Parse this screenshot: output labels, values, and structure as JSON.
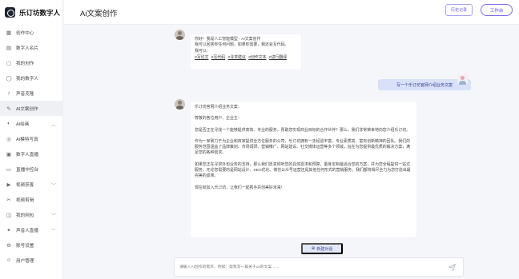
{
  "app": {
    "name": "乐订坊数字人"
  },
  "sidebar": {
    "items": [
      {
        "label": "创作中心",
        "icon": "grid-icon"
      },
      {
        "label": "数字人名片",
        "icon": "id-card-icon"
      },
      {
        "label": "我的创作",
        "icon": "document-icon"
      },
      {
        "label": "我的数字人",
        "icon": "person-icon"
      },
      {
        "label": "声音克隆",
        "icon": "sound-icon"
      },
      {
        "label": "AI文案创作",
        "icon": "edit-document-icon",
        "active": true
      },
      {
        "label": "AI绘画",
        "icon": "palette-icon",
        "expandable": true
      },
      {
        "label": "AI模特写真",
        "icon": "camera-icon"
      },
      {
        "label": "数字人直播",
        "icon": "live-icon"
      },
      {
        "label": "直播中控台",
        "icon": "monitor-icon"
      },
      {
        "label": "视频获客",
        "icon": "video-icon",
        "expandable": true
      },
      {
        "label": "视频剪辑",
        "icon": "scissors-icon"
      },
      {
        "label": "我的网包",
        "icon": "package-icon",
        "expandable": true
      },
      {
        "label": "声音人直播",
        "icon": "mic-icon",
        "expandable": true
      },
      {
        "label": "账号设置",
        "icon": "gear-icon"
      },
      {
        "label": "用户管理",
        "icon": "users-icon"
      }
    ]
  },
  "header": {
    "title": "Ai文案创作",
    "history_label": "历史记录",
    "workbench_label": "工作台"
  },
  "chat": {
    "bot_greeting": {
      "lines": [
        "你好！我是人工智能模型 - AI文案创作",
        "我可以回答你任何问题，如果你需要，我还会写代码。",
        "我可以："
      ],
      "tags": [
        "#写论文",
        "#写代码",
        "#寻求建议",
        "#创作文本",
        "#进行翻译"
      ]
    },
    "user_message": "写一个乐订坊官网介绍业务文案",
    "bot_reply": {
      "title": "乐订坊官网介绍业务文案：",
      "salutation": "尊敬的各位用户、企业主：",
      "paragraphs": [
        "您是否正在寻找一个能够提供高效、专业的服务，帮助您实现商业目标的合作伙伴？那么，我们非常荣幸地向您介绍乐订坊。",
        "作为一家致力于为企业和商家提供全方位服务的公司，乐订坊拥有一支经验丰富、专业素质高、富有创新精神的团队。我们的服务范围涵盖了品牌策划、市场调研、营销推广、网站建设、社交媒体运营等多个领域，旨在为您提供最优质的解决方案，满足您的各种需求。",
        "如果您正在寻求外包业务的支持，那么我们愿意倾听您的具体需求和预算，量身定制最适合您的方案，并为您全程提供一站式服务。无论您需要的是网站设计、SEO优化、微信公众号运营还是其他任何形式的营销服务，我们都将竭尽全力为您打造出最完美的成果。",
        "现在就加入乐订坊，让我们一起携手共创美好未来！"
      ]
    },
    "new_chat_label": "新建对话",
    "input_placeholder": "请输入AI创作的需求，例如：帮我写一篇关于xx的文案……"
  },
  "colors": {
    "accent": "#6c5ce7",
    "user_bubble": "#d9e1fa",
    "active_nav": "#eef0f4"
  }
}
